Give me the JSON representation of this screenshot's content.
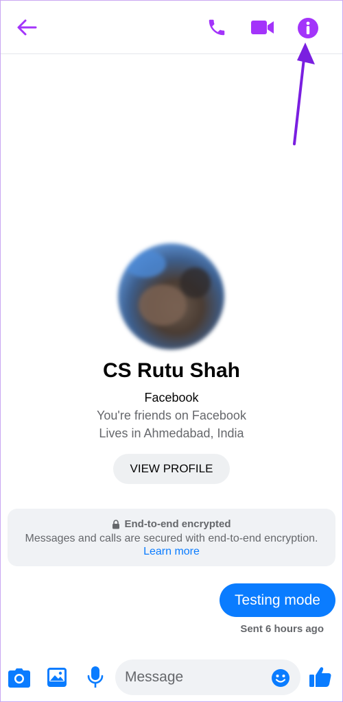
{
  "header": {
    "icons": {
      "back": "back-arrow-icon",
      "call": "phone-icon",
      "video": "video-camera-icon",
      "info": "info-icon"
    },
    "accent_color": "#a334fa"
  },
  "profile": {
    "name": "CS Rutu Shah",
    "platform": "Facebook",
    "friends_text": "You're friends on Facebook",
    "location_text": "Lives in Ahmedabad, India",
    "view_profile_label": "VIEW PROFILE"
  },
  "encryption": {
    "title": "End-to-end encrypted",
    "body": "Messages and calls are secured with end-to-end encryption.",
    "link": "Learn more"
  },
  "messages": [
    {
      "text": "Testing mode",
      "status": "Sent 6 hours ago"
    }
  ],
  "composer": {
    "placeholder": "Message",
    "accent_color": "#0a7cff",
    "icons": [
      "camera-icon",
      "gallery-icon",
      "microphone-icon",
      "emoji-icon",
      "thumbs-up-icon"
    ]
  }
}
